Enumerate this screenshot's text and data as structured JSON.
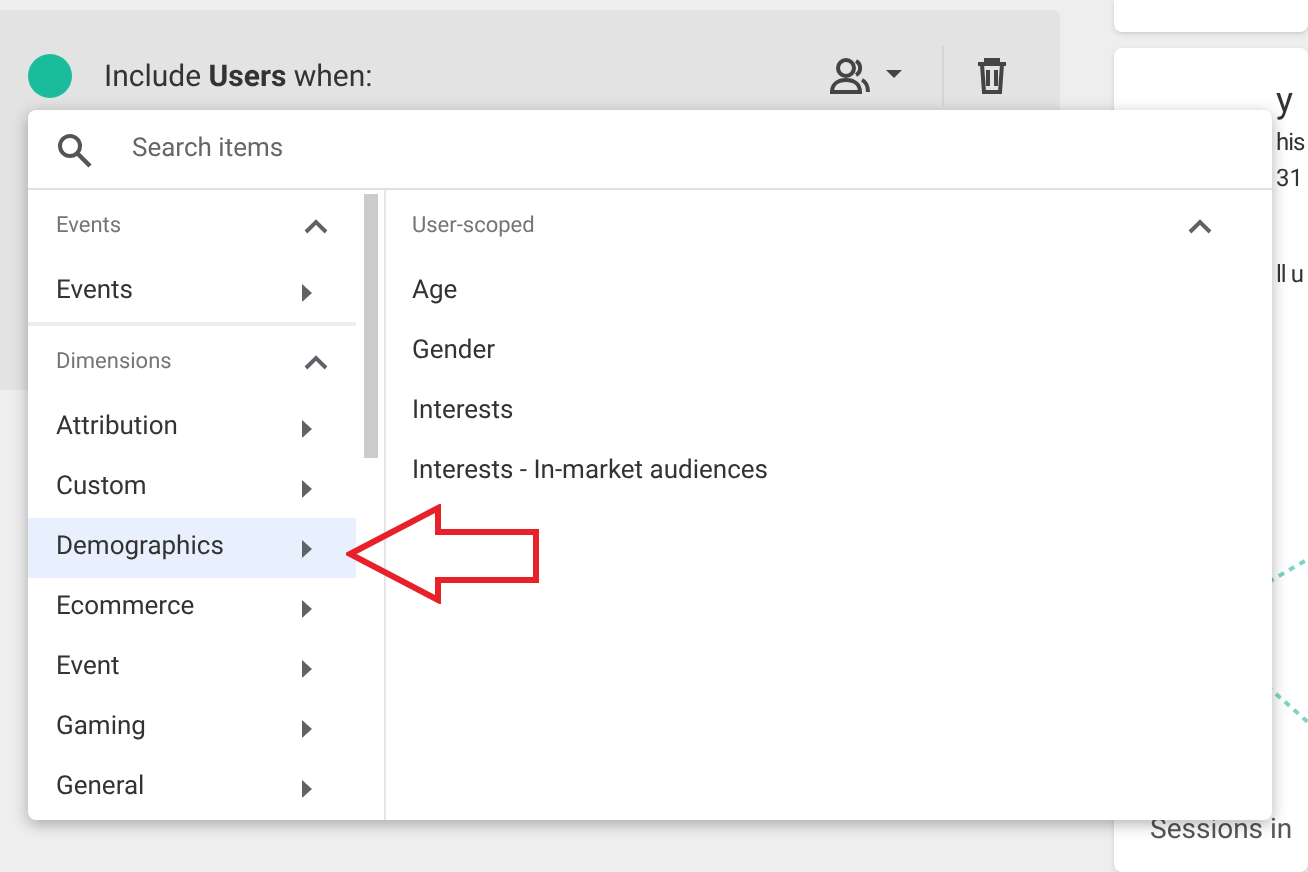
{
  "condition": {
    "text": "Include **Users** when:"
  },
  "picker": {
    "search": {
      "placeholder": "Search items"
    },
    "groups": [
      {
        "title": "Events",
        "expanded": true,
        "items": [
          {
            "label": "Events",
            "selected": false
          }
        ]
      },
      {
        "title": "Dimensions",
        "expanded": true,
        "items": [
          {
            "label": "Attribution",
            "selected": false
          },
          {
            "label": "Custom",
            "selected": false
          },
          {
            "label": "Demographics",
            "selected": true
          },
          {
            "label": "Ecommerce",
            "selected": false
          },
          {
            "label": "Event",
            "selected": false
          },
          {
            "label": "Gaming",
            "selected": false
          },
          {
            "label": "General",
            "selected": false
          }
        ]
      }
    ],
    "submenu": {
      "title": "User-scoped",
      "expanded": true,
      "items": [
        {
          "label": "Age"
        },
        {
          "label": "Gender"
        },
        {
          "label": "Interests"
        },
        {
          "label": "Interests - In-market audiences"
        }
      ]
    }
  },
  "side_card": {
    "title": "y",
    "line_1": "his",
    "line_2": "31",
    "line_3": "ll u",
    "footer": "Sessions in"
  }
}
